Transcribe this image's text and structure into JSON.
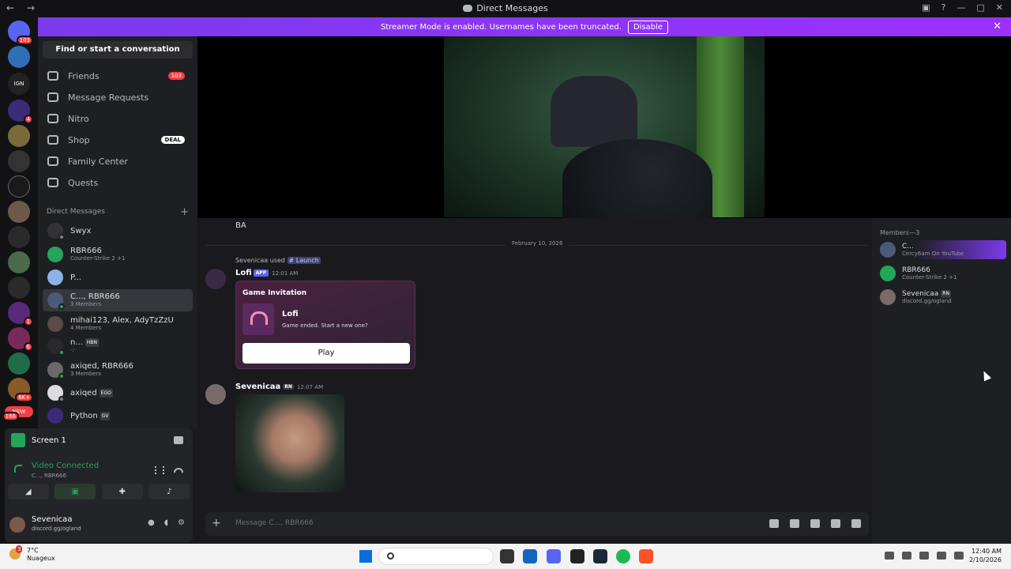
{
  "window": {
    "title": "Direct Messages"
  },
  "banner": {
    "text": "Streamer Mode is enabled. Usernames have been truncated.",
    "disable_label": "Disable"
  },
  "servers": {
    "badges": [
      "103",
      "4",
      "1",
      "6",
      "6K+",
      "166"
    ],
    "new_label": "NEW",
    "ign_label": "IGN"
  },
  "sidebar": {
    "search_label": "Find or start a conversation",
    "nav": [
      {
        "label": "Friends",
        "badge": "103"
      },
      {
        "label": "Message Requests"
      },
      {
        "label": "Nitro"
      },
      {
        "label": "Shop",
        "badge": "DEAL"
      },
      {
        "label": "Family Center"
      },
      {
        "label": "Quests"
      }
    ],
    "dm_header": "Direct Messages",
    "dms": [
      {
        "name": "Swyx",
        "sub": ""
      },
      {
        "name": "RBR666",
        "sub": "Counter-Strike 2 +1"
      },
      {
        "name": "P...",
        "sub": ""
      },
      {
        "name": "C..., RBR666",
        "sub": "3 Members"
      },
      {
        "name": "mihai123, Alex, AdyTzZzU",
        "sub": "4 Members"
      },
      {
        "name": "n...",
        "tag": "HBN",
        "sub": "·:·"
      },
      {
        "name": "axiqed, RBR666",
        "sub": "3 Members"
      },
      {
        "name": "axiqed",
        "tag": "EGO",
        "sub": ""
      },
      {
        "name": "Python",
        "tag": "GV",
        "sub": ""
      }
    ]
  },
  "voice": {
    "screen_label": "Screen 1",
    "status": "Video Connected",
    "channel": "C..., RBR666"
  },
  "user": {
    "name": "Sevenicaa",
    "status": "discord.gg/ogland"
  },
  "chat": {
    "ba_text": "BA",
    "date_divider": "February 10, 2026",
    "used_line": {
      "user": "Sevenicaa",
      "verb": "used",
      "command": "# Launch"
    },
    "lofi_msg": {
      "author": "Lofi",
      "app_tag": "APP",
      "time": "12:01 AM",
      "card_header": "Game Invitation",
      "card_title": "Lofi",
      "card_desc": "Game ended. Start a new one?",
      "play_label": "Play"
    },
    "sev_msg": {
      "author": "Sevenicaa",
      "tag": "RN",
      "time": "12:07 AM"
    },
    "composer_placeholder": "Message C..., RBR666"
  },
  "members": {
    "header": "Members—3",
    "list": [
      {
        "name": "C...",
        "sub": "Cercy6am On YouTube"
      },
      {
        "name": "RBR666",
        "sub": "Counter-Strike 2 +1"
      },
      {
        "name": "Sevenicaa",
        "tag": "RN",
        "sub": "discord.gg/ogland"
      }
    ]
  },
  "taskbar": {
    "temp": "7°C",
    "weather": "Nuageux",
    "weather_badge": "3",
    "search_label": "Search",
    "time": "12:40 AM",
    "date": "2/10/2026"
  },
  "colors": {
    "accent": "#5865f2",
    "banner": "#9b30ff",
    "online": "#23a55a",
    "danger": "#f23f43"
  }
}
